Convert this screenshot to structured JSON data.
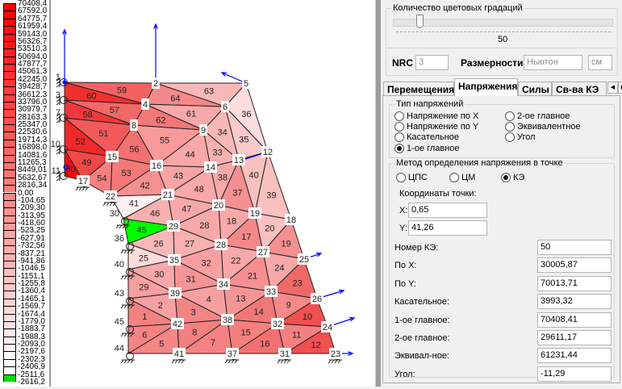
{
  "legend": {
    "values": [
      "70408,4",
      "67592,0",
      "64775,7",
      "61959,4",
      "59143,0",
      "56326,7",
      "53510,3",
      "50694,0",
      "47877,7",
      "45061,3",
      "42245,0",
      "39428,7",
      "36612,3",
      "33796,0",
      "30979,7",
      "28163,3",
      "25347,0",
      "22530,6",
      "19714,3",
      "16898,0",
      "14081,6",
      "11265,3",
      "8449,01",
      "5632,67",
      "2816,34",
      "0,00",
      "-104,65",
      "-209,30",
      "-313,95",
      "-418,60",
      "-523,25",
      "-627,91",
      "-732,56",
      "-837,21",
      "-941,86",
      "-1046,5",
      "-1151,1",
      "-1255,8",
      "-1360,4",
      "-1465,1",
      "-1569,7",
      "-1674,4",
      "-1779,0",
      "-1883,7",
      "-1988,3",
      "-2093,0",
      "-2197,6",
      "-2302,3",
      "-2406,9",
      "-2511,6",
      "-2616,2"
    ],
    "max_color": "#ff0000",
    "zero_color": "#ff8585",
    "min_color": "#ffffff",
    "highlight_color": "#00e000"
  },
  "mesh": {
    "selected_element": "45",
    "selected_color": "#00ff00",
    "load_color": "#0000ff",
    "node_labels": [
      "1",
      "2",
      "3",
      "4",
      "5",
      "6",
      "7",
      "8",
      "9",
      "10",
      "11",
      "12",
      "13",
      "14",
      "15",
      "16",
      "17",
      "18",
      "19",
      "20",
      "21",
      "22",
      "23",
      "24",
      "25",
      "26",
      "27",
      "28",
      "29",
      "30",
      "31",
      "32",
      "33",
      "34",
      "35",
      "36",
      "37",
      "38",
      "39",
      "40",
      "41",
      "42",
      "43",
      "44",
      "45"
    ],
    "supports": [
      1,
      3,
      7,
      10,
      11,
      17,
      22,
      30,
      36,
      40,
      43,
      45,
      44,
      41,
      37,
      31,
      23
    ],
    "elements": [
      {
        "id": "1",
        "nodes": [
          43,
          42,
          45
        ],
        "color": "#f48282"
      },
      {
        "id": "2",
        "nodes": [
          43,
          39,
          42
        ],
        "color": "#f7a0a0"
      },
      {
        "id": "3",
        "nodes": [
          39,
          38,
          42
        ],
        "color": "#f38484"
      },
      {
        "id": "4",
        "nodes": [
          39,
          34,
          38
        ],
        "color": "#f7a0a0"
      },
      {
        "id": "5",
        "nodes": [
          44,
          42,
          41
        ],
        "color": "#f48686"
      },
      {
        "id": "6",
        "nodes": [
          45,
          42,
          44
        ],
        "color": "#f48484"
      },
      {
        "id": "7",
        "nodes": [
          41,
          38,
          37
        ],
        "color": "#f48282"
      },
      {
        "id": "8",
        "nodes": [
          42,
          38,
          41
        ],
        "color": "#f48080"
      },
      {
        "id": "9",
        "nodes": [
          33,
          26,
          32
        ],
        "color": "#f58a8a"
      },
      {
        "id": "10",
        "nodes": [
          32,
          26,
          24
        ],
        "color": "#f05050"
      },
      {
        "id": "11",
        "nodes": [
          32,
          24,
          31
        ],
        "color": "#f48080"
      },
      {
        "id": "12",
        "nodes": [
          31,
          24,
          23
        ],
        "color": "#f05050"
      },
      {
        "id": "13",
        "nodes": [
          34,
          33,
          38
        ],
        "color": "#f59494"
      },
      {
        "id": "14",
        "nodes": [
          38,
          33,
          32
        ],
        "color": "#f17878"
      },
      {
        "id": "15",
        "nodes": [
          38,
          32,
          37
        ],
        "color": "#f48080"
      },
      {
        "id": "16",
        "nodes": [
          37,
          32,
          31
        ],
        "color": "#f27070"
      },
      {
        "id": "17",
        "nodes": [
          28,
          19,
          27
        ],
        "color": "#f48888"
      },
      {
        "id": "18",
        "nodes": [
          20,
          19,
          28
        ],
        "color": "#f8a8a8"
      },
      {
        "id": "19",
        "nodes": [
          18,
          25,
          27
        ],
        "color": "#f49090"
      },
      {
        "id": "20",
        "nodes": [
          19,
          18,
          27
        ],
        "color": "#f9c0c0"
      },
      {
        "id": "21",
        "nodes": [
          34,
          27,
          33
        ],
        "color": "#f49090"
      },
      {
        "id": "22",
        "nodes": [
          28,
          27,
          34
        ],
        "color": "#f8a8a8"
      },
      {
        "id": "23",
        "nodes": [
          25,
          26,
          33
        ],
        "color": "#f06868"
      },
      {
        "id": "24",
        "nodes": [
          27,
          25,
          33
        ],
        "color": "#f8a8a8"
      },
      {
        "id": "25",
        "nodes": [
          36,
          35,
          40
        ],
        "color": "#fcdcdc"
      },
      {
        "id": "26",
        "nodes": [
          36,
          29,
          35
        ],
        "color": "#f9b8b8"
      },
      {
        "id": "27",
        "nodes": [
          29,
          28,
          35
        ],
        "color": "#f8b0b0"
      },
      {
        "id": "28",
        "nodes": [
          29,
          20,
          28
        ],
        "color": "#f8a8a8"
      },
      {
        "id": "29",
        "nodes": [
          40,
          39,
          43
        ],
        "color": "#f7a0a0"
      },
      {
        "id": "30",
        "nodes": [
          40,
          35,
          39
        ],
        "color": "#f8a8a8"
      },
      {
        "id": "31",
        "nodes": [
          35,
          34,
          39
        ],
        "color": "#f59494"
      },
      {
        "id": "32",
        "nodes": [
          35,
          28,
          34
        ],
        "color": "#f8a0a0"
      },
      {
        "id": "33",
        "nodes": [
          9,
          13,
          14
        ],
        "color": "#f8b0b0"
      },
      {
        "id": "34",
        "nodes": [
          6,
          13,
          9
        ],
        "color": "#f9b8b8"
      },
      {
        "id": "35",
        "nodes": [
          6,
          12,
          13
        ],
        "color": "#facaca"
      },
      {
        "id": "36",
        "nodes": [
          5,
          12,
          6
        ],
        "color": "#fcdede"
      },
      {
        "id": "37",
        "nodes": [
          13,
          19,
          20
        ],
        "color": "#f59090"
      },
      {
        "id": "38",
        "nodes": [
          14,
          13,
          20
        ],
        "color": "#f8a8a8"
      },
      {
        "id": "39",
        "nodes": [
          12,
          18,
          19
        ],
        "color": "#f9c0c0"
      },
      {
        "id": "40",
        "nodes": [
          13,
          12,
          19
        ],
        "color": "#f9c0c0"
      },
      {
        "id": "41",
        "nodes": [
          22,
          21,
          30
        ],
        "color": "#fdf0f0"
      },
      {
        "id": "42",
        "nodes": [
          16,
          21,
          22
        ],
        "color": "#f59090"
      },
      {
        "id": "43",
        "nodes": [
          16,
          14,
          21
        ],
        "color": "#f8a4a4"
      },
      {
        "id": "44",
        "nodes": [
          9,
          14,
          16
        ],
        "color": "#f8a8a8"
      },
      {
        "id": "45",
        "nodes": [
          30,
          29,
          36
        ],
        "color": "#00ff00"
      },
      {
        "id": "46",
        "nodes": [
          30,
          21,
          29
        ],
        "color": "#f8b0b0"
      },
      {
        "id": "47",
        "nodes": [
          21,
          20,
          29
        ],
        "color": "#f8a8a8"
      },
      {
        "id": "48",
        "nodes": [
          14,
          20,
          21
        ],
        "color": "#f8a8a8"
      },
      {
        "id": "49",
        "nodes": [
          10,
          15,
          17
        ],
        "color": "#f04848"
      },
      {
        "id": "50",
        "nodes": [
          10,
          17,
          11
        ],
        "color": "#ff0a0a"
      },
      {
        "id": "51",
        "nodes": [
          7,
          8,
          15
        ],
        "color": "#f25a5a"
      },
      {
        "id": "52",
        "nodes": [
          7,
          15,
          10
        ],
        "color": "#f02828"
      },
      {
        "id": "53",
        "nodes": [
          15,
          16,
          22
        ],
        "color": "#f47878"
      },
      {
        "id": "54",
        "nodes": [
          17,
          15,
          22
        ],
        "color": "#f68080"
      },
      {
        "id": "55",
        "nodes": [
          8,
          9,
          16
        ],
        "color": "#f89a9a"
      },
      {
        "id": "56",
        "nodes": [
          15,
          8,
          16
        ],
        "color": "#f47070"
      },
      {
        "id": "57",
        "nodes": [
          3,
          4,
          8
        ],
        "color": "#f46868"
      },
      {
        "id": "58",
        "nodes": [
          3,
          8,
          7
        ],
        "color": "#f03838"
      },
      {
        "id": "59",
        "nodes": [
          1,
          2,
          4
        ],
        "color": "#f36262"
      },
      {
        "id": "60",
        "nodes": [
          1,
          4,
          3
        ],
        "color": "#f03030"
      },
      {
        "id": "61",
        "nodes": [
          4,
          6,
          9
        ],
        "color": "#f8a8a8"
      },
      {
        "id": "62",
        "nodes": [
          4,
          9,
          8
        ],
        "color": "#f27878"
      },
      {
        "id": "63",
        "nodes": [
          2,
          5,
          6
        ],
        "color": "#f9b8b8"
      },
      {
        "id": "64",
        "nodes": [
          2,
          6,
          4
        ],
        "color": "#f58888"
      }
    ]
  },
  "gradations": {
    "title": "Количество цветовых градаций",
    "value": "50",
    "fraction": 0.12
  },
  "settings": {
    "nrc_label": "NRC",
    "nrc_value": "3",
    "dims_label": "Размерности",
    "force_unit": "Ньютон",
    "length_unit": "см"
  },
  "tabs": [
    {
      "label": "Перемещения"
    },
    {
      "label": "Напряжения"
    },
    {
      "label": "Силы"
    },
    {
      "label": "Св-ва КЭ"
    }
  ],
  "stress_type": {
    "title": "Тип напряжений",
    "options": [
      {
        "label": "Напряжение по X",
        "checked": false
      },
      {
        "label": "Напряжение по Y",
        "checked": false
      },
      {
        "label": "Касательное",
        "checked": false
      },
      {
        "label": "1-ое главное",
        "checked": true
      },
      {
        "label": "2-ое главное",
        "checked": false
      },
      {
        "label": "Эквивалентное",
        "checked": false
      },
      {
        "label": "Угол",
        "checked": false
      }
    ]
  },
  "method": {
    "title": "Метод определения напряжения в точке",
    "options": [
      {
        "label": "ЦПС",
        "checked": false
      },
      {
        "label": "ЦМ",
        "checked": false
      },
      {
        "label": "КЭ",
        "checked": true
      }
    ],
    "coords_label": "Координаты точки:",
    "x_label": "X:",
    "x_value": "0,65",
    "y_label": "Y:",
    "y_value": "41,26",
    "results": [
      {
        "label": "Номер КЭ:",
        "value": "50"
      },
      {
        "label": "По X:",
        "value": "30005,87"
      },
      {
        "label": "По Y:",
        "value": "70013,71"
      },
      {
        "label": "Касательное:",
        "value": "3993,32"
      },
      {
        "label": "1-ое главное:",
        "value": "70408,41"
      },
      {
        "label": "2-ое главное:",
        "value": "29611,17"
      },
      {
        "label": "Эквивал-ное:",
        "value": "61231,44"
      },
      {
        "label": "Угол:",
        "value": "-11,29"
      }
    ]
  }
}
